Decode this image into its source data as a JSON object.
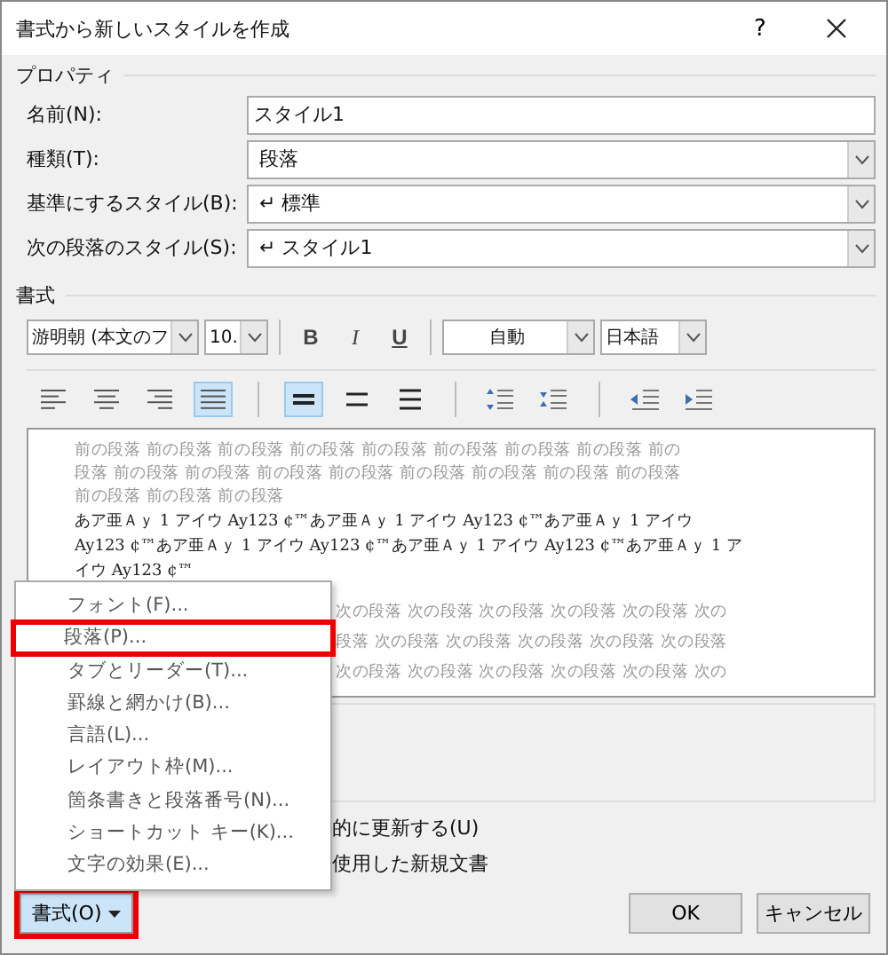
{
  "window": {
    "title": "書式から新しいスタイルを作成",
    "help": "?"
  },
  "properties": {
    "heading": "プロパティ",
    "fields": [
      {
        "label": "名前(N):",
        "value": "スタイル1",
        "kind": "text"
      },
      {
        "label": "種類(T):",
        "value": "段落",
        "kind": "select"
      },
      {
        "label": "基準にするスタイル(B):",
        "value": "↵ 標準",
        "kind": "select"
      },
      {
        "label": "次の段落のスタイル(S):",
        "value": "↵ スタイル1",
        "kind": "select"
      }
    ]
  },
  "format": {
    "heading": "書式",
    "font": "游明朝 (本文のフ",
    "size": "10.",
    "bold": "B",
    "italic": "I",
    "underline": "U",
    "font_color": "自動",
    "language": "日本語",
    "tools": [
      {
        "kind": "align-left",
        "selected": false
      },
      {
        "kind": "align-center",
        "selected": false
      },
      {
        "kind": "align-right",
        "selected": false
      },
      {
        "kind": "justify",
        "selected": true
      },
      {
        "kind": "sep"
      },
      {
        "kind": "single",
        "selected": true
      },
      {
        "kind": "one-half",
        "selected": false
      },
      {
        "kind": "double",
        "selected": false
      },
      {
        "kind": "sep"
      },
      {
        "kind": "space-more",
        "selected": false
      },
      {
        "kind": "space-less",
        "selected": false
      },
      {
        "kind": "sep"
      },
      {
        "kind": "indent-less",
        "selected": false
      },
      {
        "kind": "indent-more",
        "selected": false
      }
    ]
  },
  "preview": {
    "previous": [
      "前の段落 前の段落 前の段落 前の段落 前の段落 前の段落 前の段落 前の段落 前の",
      "段落 前の段落 前の段落 前の段落 前の段落 前の段落 前の段落 前の段落 前の段落",
      "前の段落 前の段落 前の段落"
    ],
    "sample": [
      "あア亜Ａｙ 1 アイウ Ay123 ¢™あア亜Ａｙ 1 アイウ Ay123 ¢™あア亜Ａｙ 1 アイウ",
      "Ay123 ¢™あア亜Ａｙ 1 アイウ Ay123 ¢™あア亜Ａｙ 1 アイウ Ay123 ¢™あア亜Ａｙ 1 ア",
      "イウ Ay123 ¢™"
    ],
    "next": [
      "次の段落 次の段落 次の段落 次の段落 次の段落 次の",
      "段落 次の段落 次の段落 次の段落 次の段落 次の段落",
      "次の段落 次の段落 次の段落 次の段落 次の段落 次の"
    ]
  },
  "options": [
    "的に更新する(U)",
    "使用した新規文書"
  ],
  "buttons": {
    "format": {
      "label": "書式(O)",
      "highlighted": true
    },
    "ok": "OK",
    "cancel": "キャンセル"
  },
  "menu": [
    {
      "label": "フォント(F)...",
      "selected": false
    },
    {
      "label": "段落(P)...",
      "selected": true
    },
    {
      "label": "タブとリーダー(T)...",
      "selected": false
    },
    {
      "label": "罫線と網かけ(B)...",
      "selected": false
    },
    {
      "label": "言語(L)...",
      "selected": false
    },
    {
      "label": "レイアウト枠(M)...",
      "selected": false
    },
    {
      "label": "箇条書きと段落番号(N)...",
      "selected": false
    },
    {
      "label": "ショートカット キー(K)...",
      "selected": false
    },
    {
      "label": "文字の効果(E)...",
      "selected": false
    }
  ]
}
